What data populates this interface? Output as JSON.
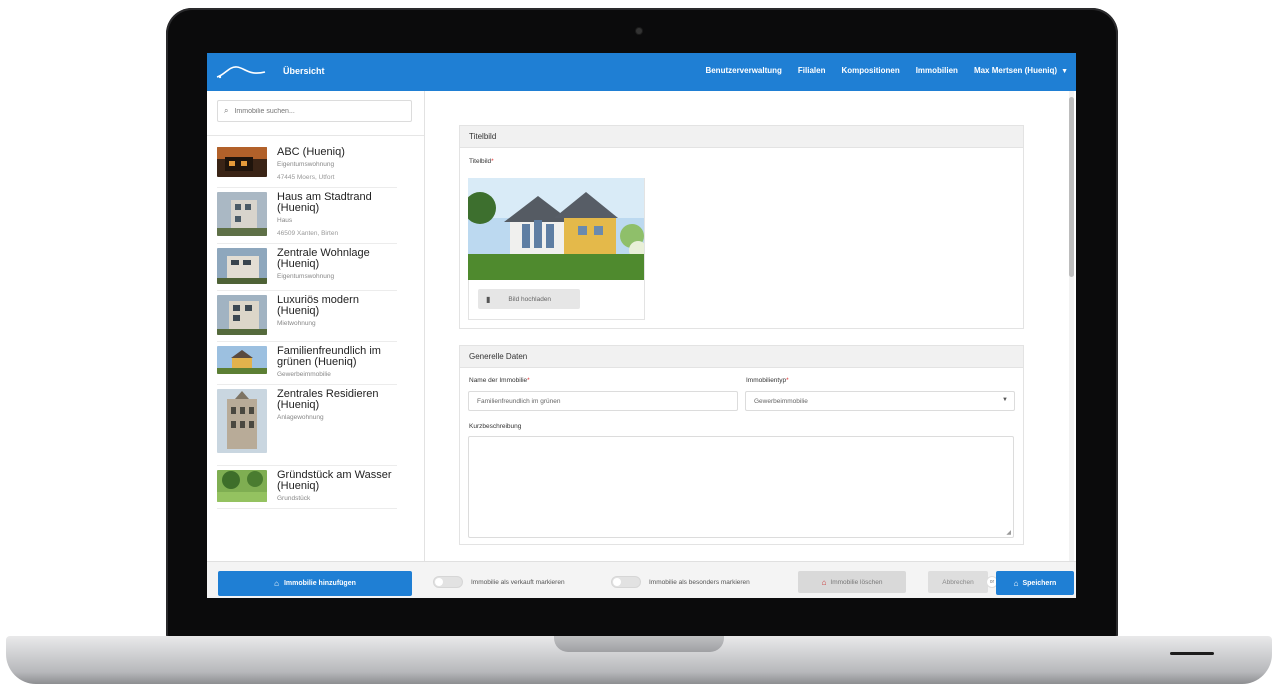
{
  "topbar": {
    "title": "Übersicht",
    "nav": [
      "Benutzerverwaltung",
      "Filialen",
      "Kompositionen",
      "Immobilien"
    ],
    "user": "Max Mertsen (Hueniq)"
  },
  "sidebar": {
    "search_placeholder": "Immobilie suchen...",
    "items": [
      {
        "name": "ABC (Hueniq)",
        "type": "Eigentumswohnung",
        "location": "47445 Moers, Utfort"
      },
      {
        "name": "Haus am Stadtrand (Hueniq)",
        "type": "Haus",
        "location": "46509 Xanten, Birten"
      },
      {
        "name": "Zentrale Wohnlage (Hueniq)",
        "type": "Eigentumswohnung",
        "location": ""
      },
      {
        "name": "Luxuriös modern (Hueniq)",
        "type": "Mietwohnung",
        "location": ""
      },
      {
        "name": "Familienfreundlich im grünen (Hueniq)",
        "type": "Gewerbeimmobilie",
        "location": ""
      },
      {
        "name": "Zentrales Residieren (Hueniq)",
        "type": "Anlagewohnung",
        "location": ""
      },
      {
        "name": "Gründstück am Wasser (Hueniq)",
        "type": "Grundstück",
        "location": ""
      }
    ]
  },
  "main": {
    "title_panel": {
      "heading": "Titelbild",
      "image_label": "Titelbild",
      "upload_label": "Bild hochladen"
    },
    "general_panel": {
      "heading": "Generelle Daten",
      "name_label": "Name der Immobilie",
      "name_value": "Familienfreundlich im grünen",
      "type_label": "Immobilientyp",
      "type_value": "Gewerbeimmobilie",
      "description_label": "Kurzbeschreibung"
    }
  },
  "footer": {
    "add_label": "Immobilie hinzufügen",
    "sold_toggle_label": "Immobilie als verkauft markieren",
    "special_toggle_label": "Immobilie als besonders markieren",
    "delete_label": "Immobilie löschen",
    "cancel_label": "Abbrechen",
    "or_label": "or",
    "save_label": "Speichern"
  },
  "colors": {
    "accent": "#1f7fd4",
    "frame": "#0b0b0c"
  },
  "icons": [
    "search-icon",
    "file-icon",
    "house-icon",
    "caret-down-icon"
  ]
}
